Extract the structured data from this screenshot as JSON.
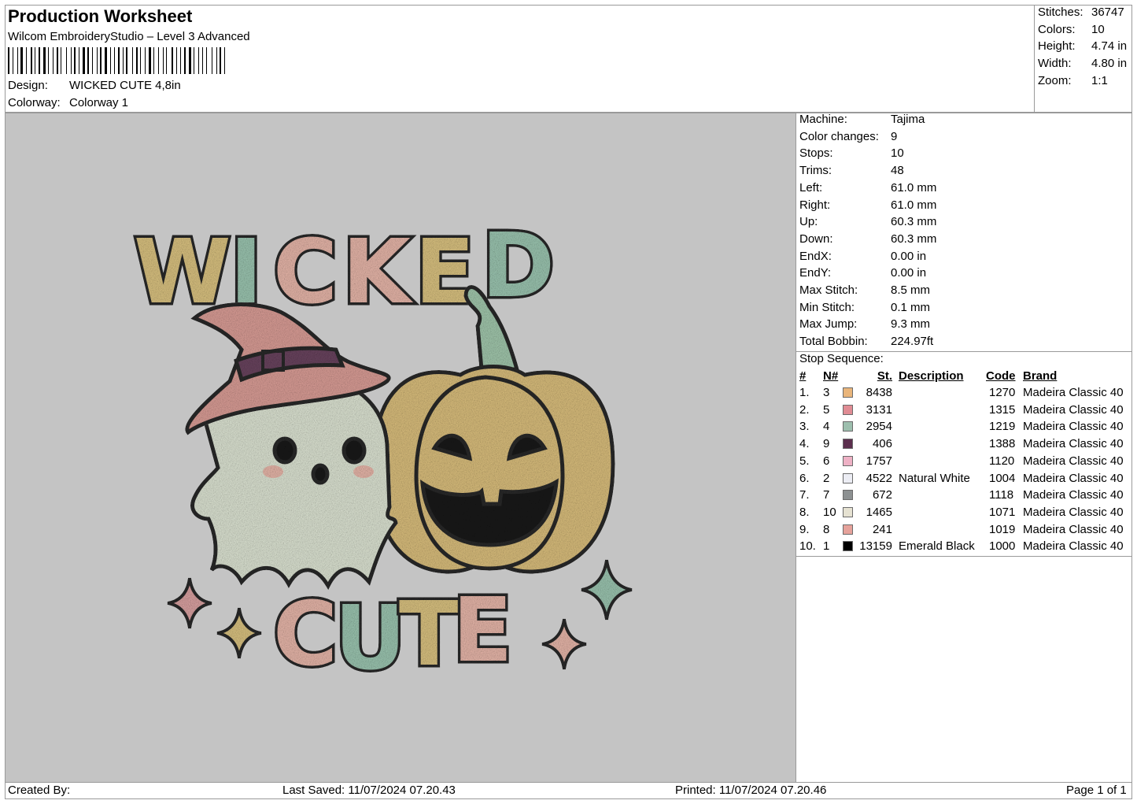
{
  "header": {
    "title": "Production Worksheet",
    "software": "Wilcom EmbroideryStudio – Level 3 Advanced",
    "design_label": "Design:",
    "design_value": "WICKED CUTE 4,8in",
    "colorway_label": "Colorway:",
    "colorway_value": "Colorway 1"
  },
  "summary": [
    {
      "label": "Stitches:",
      "value": "36747"
    },
    {
      "label": "Colors:",
      "value": "10"
    },
    {
      "label": "Height:",
      "value": "4.74 in"
    },
    {
      "label": "Width:",
      "value": "4.80 in"
    },
    {
      "label": "Zoom:",
      "value": "1:1"
    }
  ],
  "machine_info": [
    {
      "label": "Machine:",
      "value": "Tajima"
    },
    {
      "label": "Color changes:",
      "value": "9"
    },
    {
      "label": "Stops:",
      "value": "10"
    },
    {
      "label": "Trims:",
      "value": "48"
    },
    {
      "label": "Left:",
      "value": "61.0 mm"
    },
    {
      "label": "Right:",
      "value": "61.0 mm"
    },
    {
      "label": "Up:",
      "value": "60.3 mm"
    },
    {
      "label": "Down:",
      "value": "60.3 mm"
    },
    {
      "label": "EndX:",
      "value": "0.00 in"
    },
    {
      "label": "EndY:",
      "value": "0.00 in"
    },
    {
      "label": "Max Stitch:",
      "value": "8.5 mm"
    },
    {
      "label": "Min Stitch:",
      "value": "0.1 mm"
    },
    {
      "label": "Max Jump:",
      "value": "9.3 mm"
    },
    {
      "label": "Total Bobbin:",
      "value": "224.97ft"
    }
  ],
  "stop_sequence": {
    "title": "Stop Sequence:",
    "columns": [
      "#",
      "N#",
      "St.",
      "Description",
      "Code",
      "Brand"
    ],
    "rows": [
      {
        "idx": "1.",
        "n": "3",
        "color": "#e9b57b",
        "st": "8438",
        "desc": "",
        "code": "1270",
        "brand": "Madeira Classic 40"
      },
      {
        "idx": "2.",
        "n": "5",
        "color": "#e08c94",
        "st": "3131",
        "desc": "",
        "code": "1315",
        "brand": "Madeira Classic 40"
      },
      {
        "idx": "3.",
        "n": "4",
        "color": "#9dbfae",
        "st": "2954",
        "desc": "",
        "code": "1219",
        "brand": "Madeira Classic 40"
      },
      {
        "idx": "4.",
        "n": "9",
        "color": "#5c2f4e",
        "st": "406",
        "desc": "",
        "code": "1388",
        "brand": "Madeira Classic 40"
      },
      {
        "idx": "5.",
        "n": "6",
        "color": "#eeb1c5",
        "st": "1757",
        "desc": "",
        "code": "1120",
        "brand": "Madeira Classic 40"
      },
      {
        "idx": "6.",
        "n": "2",
        "color": "#ecedf4",
        "st": "4522",
        "desc": "Natural White",
        "code": "1004",
        "brand": "Madeira Classic 40"
      },
      {
        "idx": "7.",
        "n": "7",
        "color": "#8d9192",
        "st": "672",
        "desc": "",
        "code": "1118",
        "brand": "Madeira Classic 40"
      },
      {
        "idx": "8.",
        "n": "10",
        "color": "#e6e2d2",
        "st": "1465",
        "desc": "",
        "code": "1071",
        "brand": "Madeira Classic 40"
      },
      {
        "idx": "9.",
        "n": "8",
        "color": "#e6a29b",
        "st": "241",
        "desc": "",
        "code": "1019",
        "brand": "Madeira Classic 40"
      },
      {
        "idx": "10.",
        "n": "1",
        "color": "#000000",
        "st": "13159",
        "desc": "Emerald Black",
        "code": "1000",
        "brand": "Madeira Classic 40"
      }
    ]
  },
  "footer": {
    "created_by": "Created By:",
    "last_saved": "Last Saved: 11/07/2024 07.20.43",
    "printed": "Printed: 11/07/2024 07.20.46",
    "page": "Page 1 of 1"
  },
  "artwork": {
    "word_top": [
      "W",
      "I",
      "C",
      "K",
      "E",
      "D"
    ],
    "word_bottom": [
      "C",
      "U",
      "T",
      "E"
    ],
    "colors": {
      "canvas": "#c4c4c4",
      "outline": "#2a2a2a",
      "mustard": "#dcc482",
      "mint": "#9dc7b2",
      "pink": "#e9b8ab",
      "ghost": "#dfe6d5",
      "pumpkin": "#dcc07e",
      "hat": "#dc9f98",
      "band": "#6b4560",
      "stem": "#a3c9ae"
    }
  }
}
